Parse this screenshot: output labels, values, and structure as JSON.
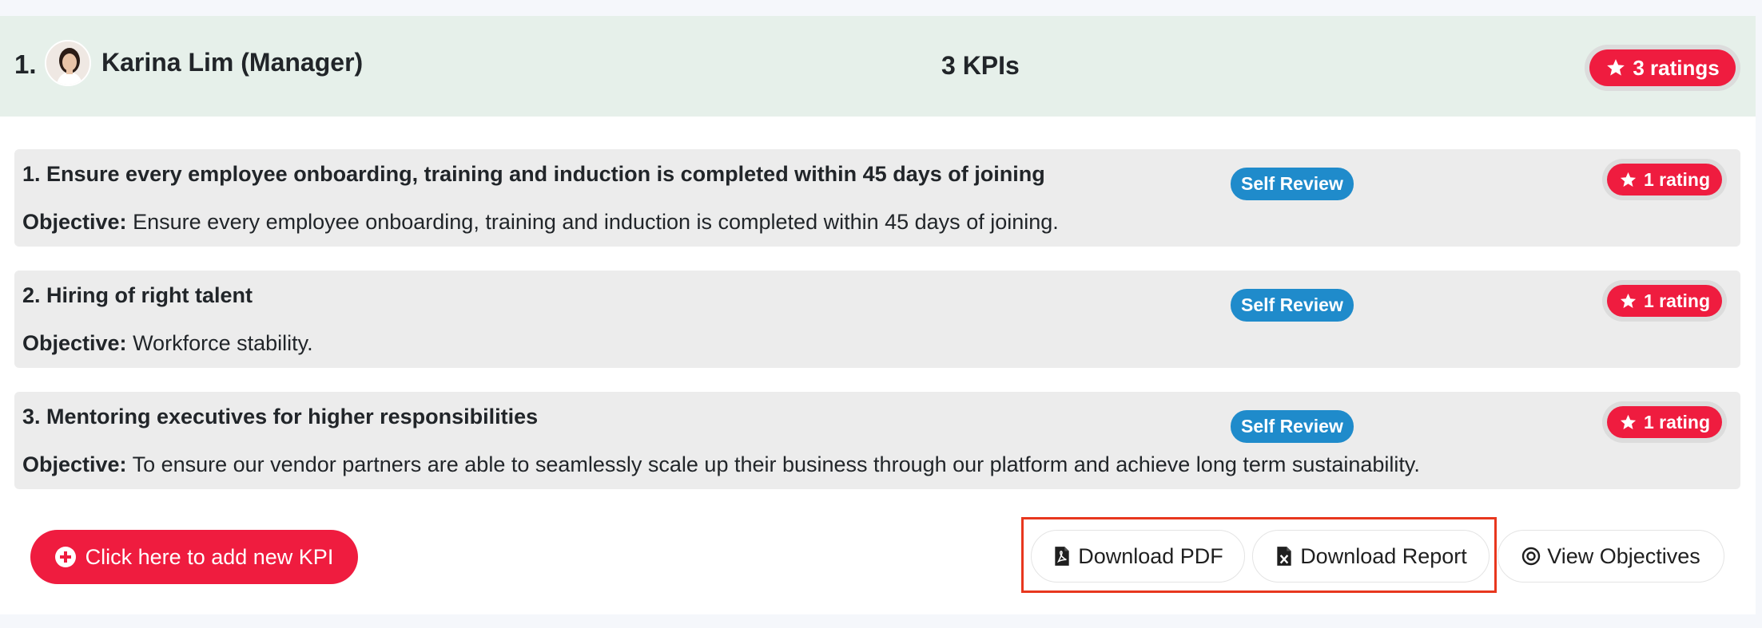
{
  "header": {
    "index": "1.",
    "name": "Karina Lim (Manager)",
    "kpi_count": "3 KPIs",
    "ratings": "3 ratings"
  },
  "kpis": [
    {
      "title": "1. Ensure every employee onboarding, training and induction is completed within 45 days of joining",
      "objective_label": "Objective:",
      "objective": "Ensure every employee onboarding, training and induction is completed within 45 days of joining.",
      "badge": "Self Review",
      "rating": "1 rating"
    },
    {
      "title": "2. Hiring of right talent",
      "objective_label": "Objective:",
      "objective": "Workforce stability.",
      "badge": "Self Review",
      "rating": "1 rating"
    },
    {
      "title": "3. Mentoring executives for higher responsibilities",
      "objective_label": "Objective:",
      "objective": "To ensure our vendor partners are able to seamlessly scale up their business through our platform and achieve long term sustainability.",
      "badge": "Self Review",
      "rating": "1 rating"
    }
  ],
  "actions": {
    "add_kpi": "Click here to add new KPI",
    "download_pdf": "Download PDF",
    "download_report": "Download Report",
    "view_objectives": "View Objectives"
  },
  "colors": {
    "header_bg": "#e6f0ea",
    "accent_red": "#ef1c3f",
    "badge_blue": "#1f8bcb",
    "kpi_bg": "#ececec",
    "highlight": "#e8371e"
  },
  "icons": {
    "star": "star-icon",
    "plus": "plus-circle-icon",
    "pdf": "file-pdf-icon",
    "excel": "file-excel-icon",
    "target": "target-icon"
  }
}
